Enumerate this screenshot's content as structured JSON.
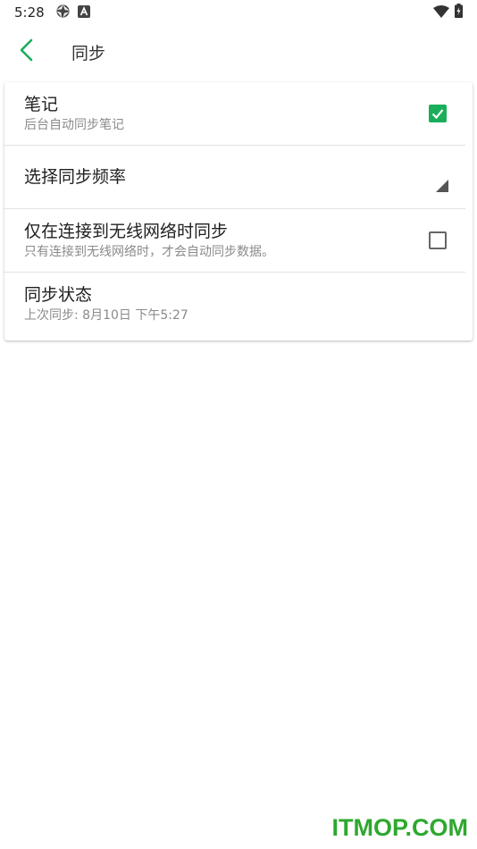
{
  "status_bar": {
    "time": "5:28",
    "icons": [
      "aperture-icon",
      "a-badge-icon",
      "wifi-icon",
      "battery-icon"
    ]
  },
  "app_bar": {
    "title": "同步",
    "accent_color": "#1aae5b"
  },
  "preferences": [
    {
      "title": "笔记",
      "summary": "后台自动同步笔记",
      "control": "checkbox",
      "checked": true
    },
    {
      "title": "选择同步频率",
      "summary": "",
      "control": "dropdown"
    },
    {
      "title": "仅在连接到无线网络时同步",
      "summary": "只有连接到无线网络时，才会自动同步数据。",
      "control": "checkbox",
      "checked": false
    },
    {
      "title": "同步状态",
      "summary": "上次同步: 8月10日 下午5:27",
      "control": "none"
    }
  ],
  "watermark": "ITMOP.COM"
}
